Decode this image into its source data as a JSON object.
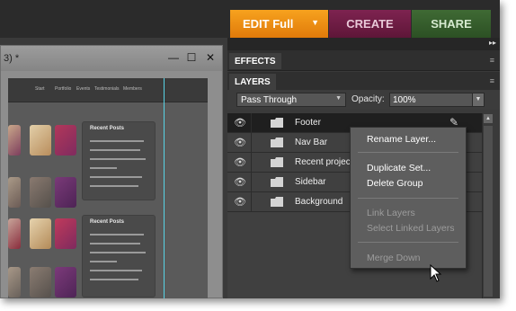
{
  "top_tabs": {
    "edit": "EDIT Full",
    "create": "CREATE",
    "share": "SHARE"
  },
  "document": {
    "title": "3) *",
    "minimize": "—",
    "maximize": "☐",
    "close": "✕"
  },
  "canvas_nav": [
    "Start",
    "Portfolio",
    "Events",
    "Testimonials",
    "Members"
  ],
  "panels": {
    "effects": "EFFECTS",
    "layers": "LAYERS"
  },
  "layer_options": {
    "blend_mode": "Pass Through",
    "opacity_label": "Opacity:",
    "opacity_value": "100%"
  },
  "layers": [
    {
      "name": "Footer",
      "selected": true
    },
    {
      "name": "Nav Bar",
      "selected": false
    },
    {
      "name": "Recent projects",
      "selected": false
    },
    {
      "name": "Sidebar",
      "selected": false
    },
    {
      "name": "Background",
      "selected": false
    }
  ],
  "context_menu": {
    "rename": "Rename Layer...",
    "duplicate": "Duplicate Set...",
    "delete": "Delete Group",
    "link": "Link Layers",
    "select_linked": "Select Linked Layers",
    "merge_down": "Merge Down"
  },
  "colors": {
    "edit_tab": "#f7a21e",
    "create_tab": "#7e2350",
    "share_tab": "#3f6a34",
    "guide": "#57d3e6"
  }
}
